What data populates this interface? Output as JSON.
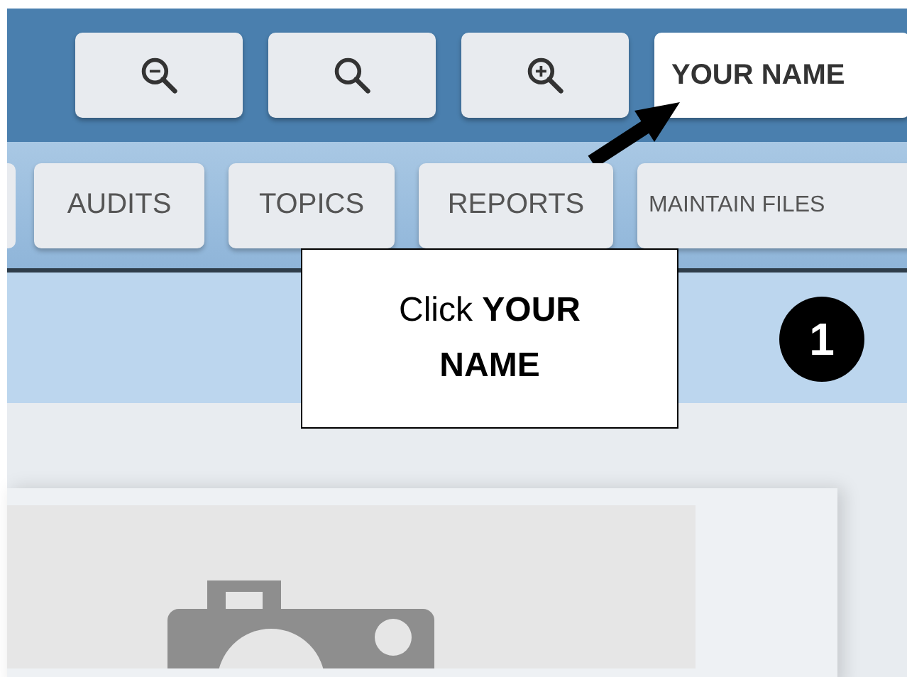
{
  "toolbar": [
    {
      "kind": "zoom-out"
    },
    {
      "kind": "zoom-reset"
    },
    {
      "kind": "zoom-in"
    },
    {
      "kind": "text",
      "label": "YOUR NAME"
    }
  ],
  "nav": [
    {
      "label": "AUDITS",
      "kind": "tab"
    },
    {
      "label": "TOPICS",
      "kind": "tab"
    },
    {
      "label": "REPORTS",
      "kind": "tab"
    },
    {
      "label": "MAINTAIN FILES",
      "kind": "small-tab"
    }
  ],
  "annotation": {
    "callout": "Click **YOUR NAME**",
    "step": "1"
  }
}
